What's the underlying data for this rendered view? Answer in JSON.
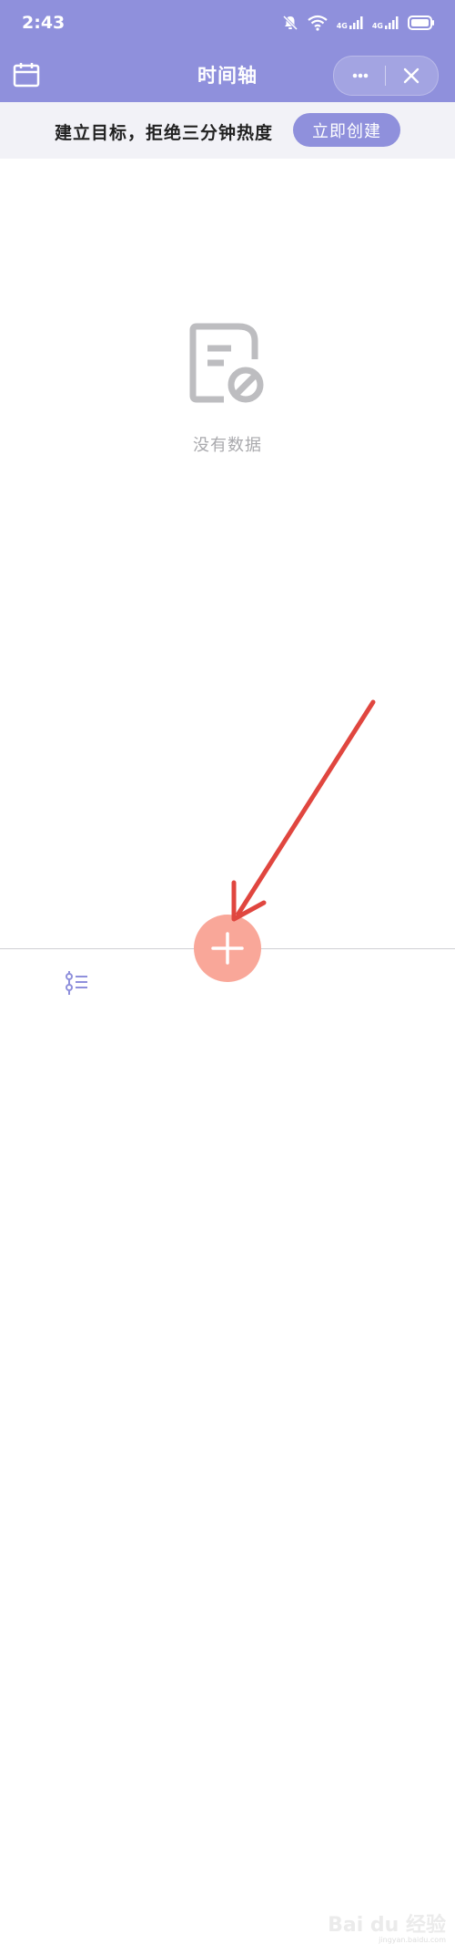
{
  "status_bar": {
    "time": "2:43",
    "network_label_1": "4G",
    "network_label_2": "4G"
  },
  "nav": {
    "title": "时间轴",
    "more_icon": "more-dots-icon",
    "close_icon": "close-icon"
  },
  "banner": {
    "text": "建立目标，拒绝三分钟热度",
    "button_label": "立即创建"
  },
  "empty_state": {
    "text": "没有数据",
    "icon": "no-data-document-icon"
  },
  "tab_bar": {
    "timeline_icon": "timeline-list-icon",
    "add_icon": "plus-icon"
  },
  "watermark": {
    "text": "Bai du 经验",
    "sub": "jingyan.baidu.com"
  },
  "colors": {
    "header": "#8f90dc",
    "banner_bg": "#f2f2f7",
    "fab": "#f9a799",
    "arrow": "#e0463f",
    "empty_gray": "#a9a9ad"
  }
}
